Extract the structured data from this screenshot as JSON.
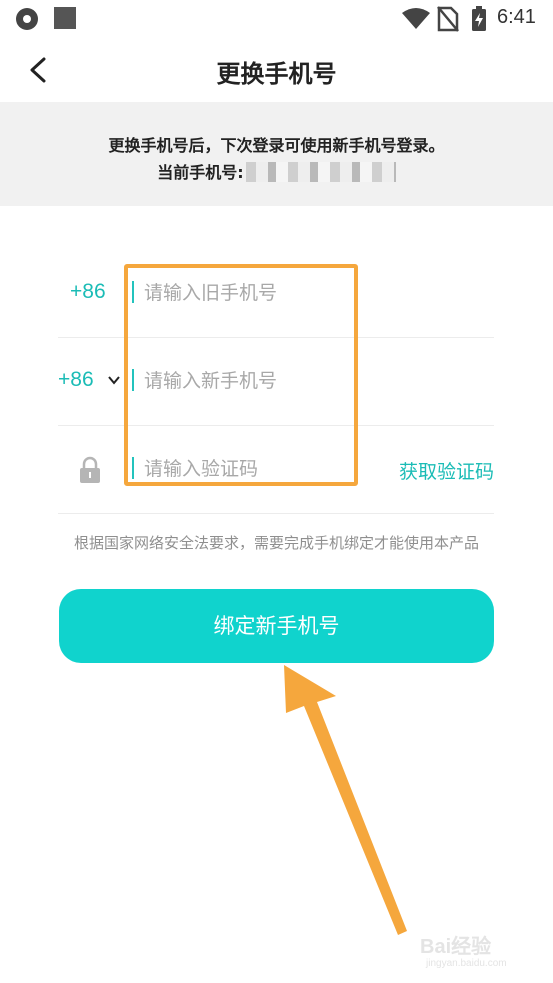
{
  "status_bar": {
    "time": "6:41",
    "icons": [
      "app-icon",
      "app-icon-square",
      "wifi-icon",
      "no-sim-icon",
      "battery-charging-icon"
    ]
  },
  "header": {
    "title": "更换手机号",
    "back_icon": "chevron-left-icon"
  },
  "notice": {
    "line1": "更换手机号后，下次登录可使用新手机号登录。",
    "line2_label": "当前手机号:"
  },
  "form": {
    "old_phone": {
      "country_code": "+86",
      "placeholder": "请输入旧手机号",
      "value": ""
    },
    "new_phone": {
      "country_code": "+86",
      "placeholder": "请输入新手机号",
      "value": ""
    },
    "code": {
      "placeholder": "请输入验证码",
      "value": "",
      "get_code_label": "获取验证码"
    }
  },
  "tip": "根据国家网络安全法要求，需要完成手机绑定才能使用本产品",
  "bind_button": "绑定新手机号",
  "watermark": {
    "brand": "Bai经验",
    "sub": "jingyan.baidu.com"
  },
  "colors": {
    "accent": "#1bbcb6",
    "button": "#10d3cd",
    "highlight": "#f5a73d",
    "notice_bg": "#f1f1f1"
  }
}
